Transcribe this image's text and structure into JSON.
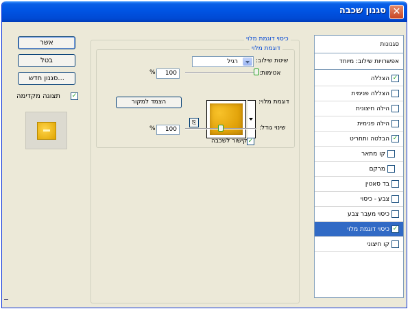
{
  "window": {
    "title": "סגנון שכבה",
    "close_glyph": "✕"
  },
  "buttons": {
    "ok": "אשר",
    "cancel": "בטל",
    "new_style": "סגנון חדש...",
    "snap": "הצמד למקור"
  },
  "preview": {
    "label": "תצוגה מקדימה",
    "checked": true
  },
  "pattern_overlay": {
    "group_title": "כיסוי דוגמת מלוי",
    "sub_title": "דוגמת מלוי",
    "blend_mode_label": "שיטת שילוב:",
    "blend_mode_value": "רגיל",
    "opacity_label": "אטימות:",
    "opacity_value": "100",
    "opacity_unit": "%",
    "opacity_level": 1.0,
    "pattern_label": "דוגמת מלוי:",
    "scale_label": "שינוי גודל:",
    "scale_value": "100",
    "scale_unit": "%",
    "scale_level": 0.5,
    "link_label": "קישור לשכבה",
    "link_checked": true
  },
  "styles_list": {
    "header": "סגנונות",
    "blend_options": "אפשרויות שילוב: מיוחד",
    "items": [
      {
        "label": "הצללה",
        "checked": true
      },
      {
        "label": "הצללה פנימית",
        "checked": false
      },
      {
        "label": "הילה חיצונית",
        "checked": false
      },
      {
        "label": "הילה פנימית",
        "checked": false
      },
      {
        "label": "הבלטה ותחריט",
        "checked": true
      },
      {
        "label": "קו מתאר",
        "checked": false
      },
      {
        "label": "מרקם",
        "checked": false
      },
      {
        "label": "בד סאטין",
        "checked": false
      },
      {
        "label": "צבע - כיסוי",
        "checked": false
      },
      {
        "label": "כיסוי מעבר צבע",
        "checked": false
      },
      {
        "label": "כיסוי דוגמת מלוי",
        "checked": true
      },
      {
        "label": "קו חיצוני",
        "checked": false
      }
    ]
  },
  "colors": {
    "titlebar": "#0054e3",
    "selection": "#316ac5",
    "group_title": "#0046d5",
    "face": "#ece9d8"
  }
}
